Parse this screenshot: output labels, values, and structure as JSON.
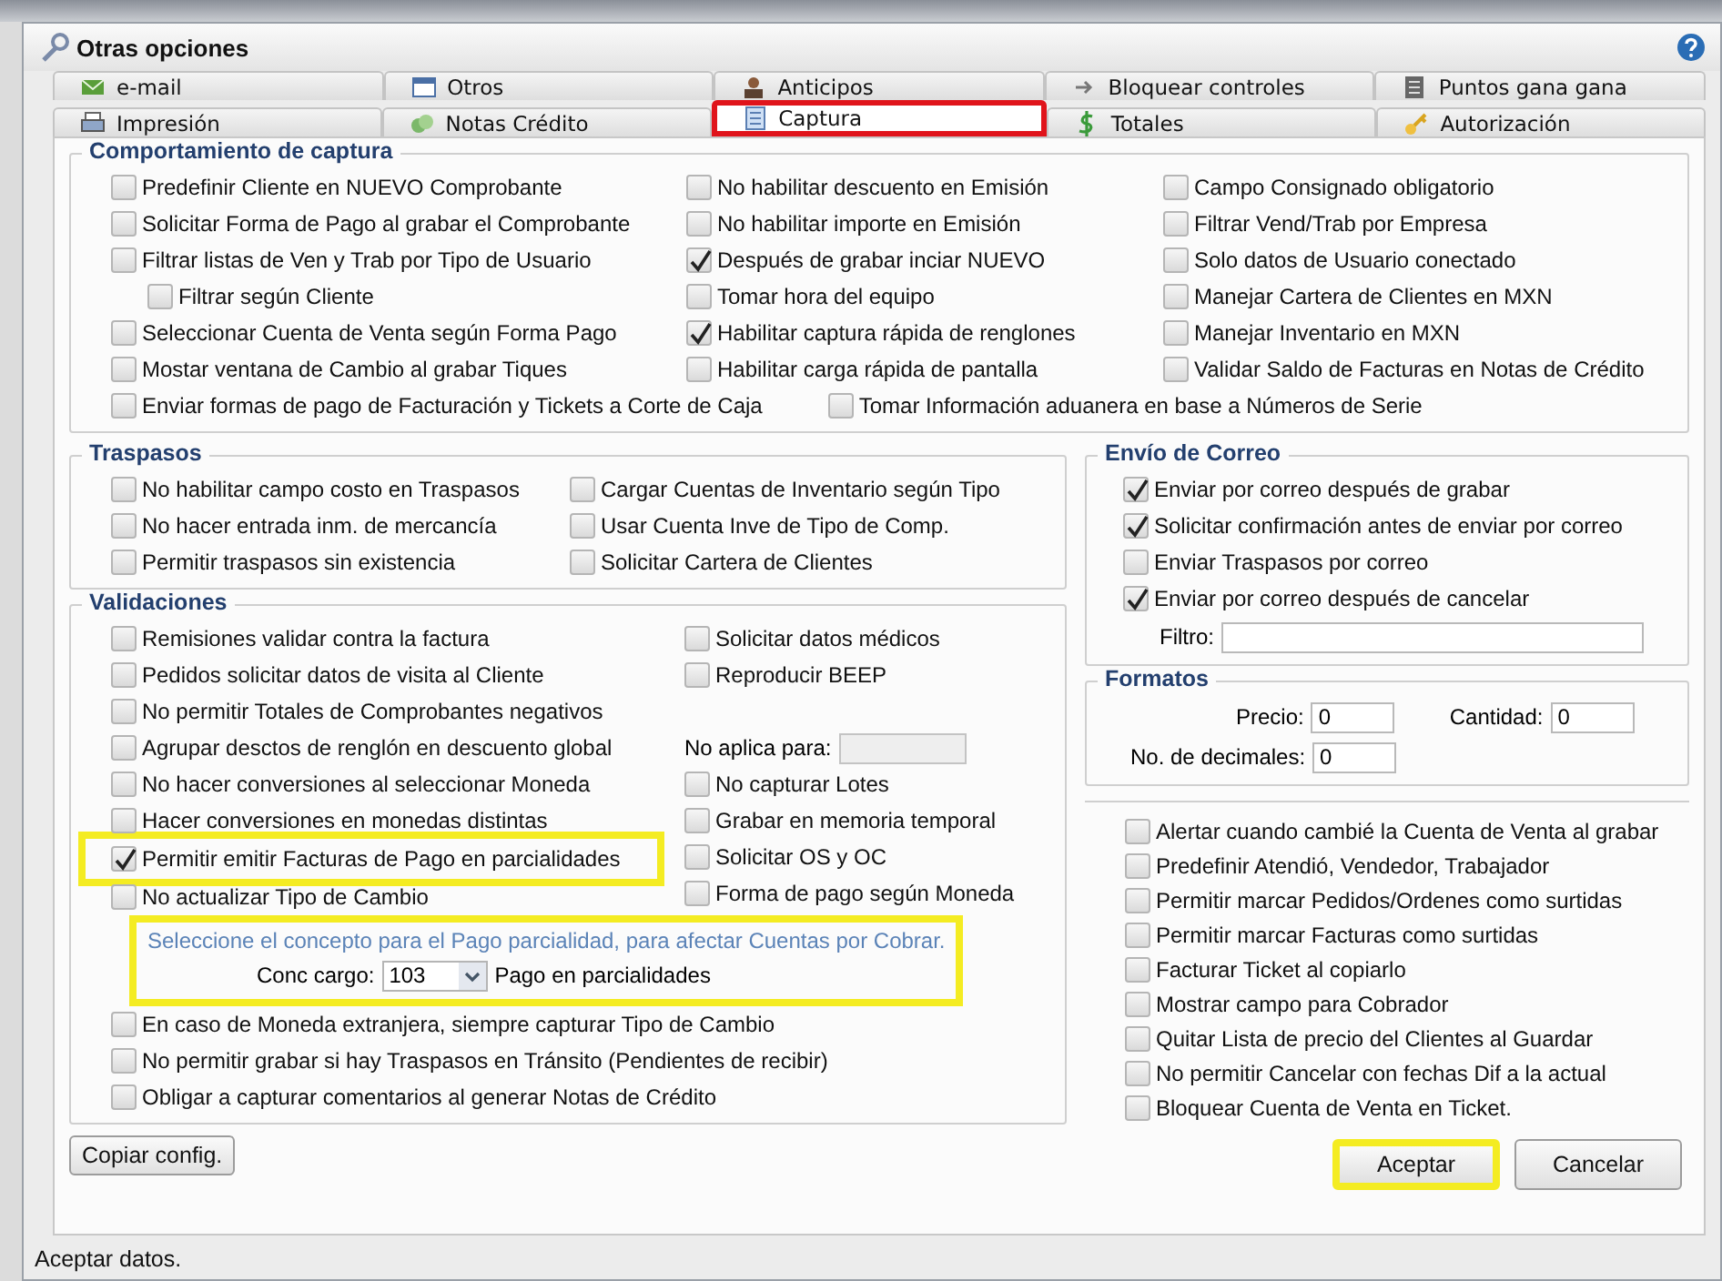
{
  "window": {
    "title": "Otras opciones"
  },
  "tab_rows": [
    {
      "tabs": [
        {
          "label": "e-mail",
          "selected": false,
          "highlighted": false
        },
        {
          "label": "Otros",
          "selected": false,
          "highlighted": false
        },
        {
          "label": "Anticipos",
          "selected": false,
          "highlighted": false
        },
        {
          "label": "Bloquear controles",
          "selected": false,
          "highlighted": false
        },
        {
          "label": "Puntos gana gana",
          "selected": false,
          "highlighted": false
        }
      ]
    },
    {
      "tabs": [
        {
          "label": "Impresión",
          "selected": false,
          "highlighted": false
        },
        {
          "label": "Notas Crédito",
          "selected": false,
          "highlighted": false
        },
        {
          "label": "Captura",
          "selected": true,
          "highlighted": true
        },
        {
          "label": "Totales",
          "selected": false,
          "highlighted": false
        },
        {
          "label": "Autorización",
          "selected": false,
          "highlighted": false
        }
      ]
    }
  ],
  "comportamiento": {
    "title": "Comportamiento de captura",
    "columns": [
      [
        {
          "label": "Predefinir Cliente en NUEVO Comprobante",
          "checked": false
        },
        {
          "label": "Solicitar Forma de Pago al grabar el Comprobante",
          "checked": false
        },
        {
          "label": "Filtrar listas de Ven y Trab por Tipo de Usuario",
          "checked": false,
          "children": [
            {
              "label": "Filtrar según Cliente",
              "checked": false
            }
          ]
        },
        {
          "label": "Seleccionar Cuenta de Venta según Forma Pago",
          "checked": false
        },
        {
          "label": "Mostar ventana de Cambio al grabar Tiques",
          "checked": false
        }
      ],
      [
        {
          "label": "No habilitar descuento en Emisión",
          "checked": false
        },
        {
          "label": "No habilitar importe en Emisión",
          "checked": false
        },
        {
          "label": "Después de grabar inciar NUEVO",
          "checked": true
        },
        {
          "label": "Tomar hora del equipo",
          "checked": false
        },
        {
          "label": "Habilitar captura rápida de renglones",
          "checked": true
        },
        {
          "label": "Habilitar carga rápida de pantalla",
          "checked": false
        }
      ],
      [
        {
          "label": "Campo Consignado obligatorio",
          "checked": false
        },
        {
          "label": "Filtrar Vend/Trab por Empresa",
          "checked": false
        },
        {
          "label": "Solo datos de Usuario conectado",
          "checked": false
        },
        {
          "label": "Manejar Cartera de Clientes en MXN",
          "checked": false
        },
        {
          "label": "Manejar Inventario en MXN",
          "checked": false
        },
        {
          "label": "Validar Saldo de Facturas en Notas de Crédito",
          "checked": false
        }
      ]
    ],
    "footer": [
      {
        "label": "Enviar formas de pago de Facturación y Tickets a Corte de Caja",
        "checked": false
      },
      {
        "label": "Tomar Información aduanera en base a Números de Serie",
        "checked": false
      }
    ]
  },
  "traspasos": {
    "title": "Traspasos",
    "columns": [
      [
        {
          "label": "No habilitar campo costo en Traspasos",
          "checked": false
        },
        {
          "label": "No hacer entrada inm. de mercancía",
          "checked": false
        },
        {
          "label": "Permitir traspasos sin existencia",
          "checked": false
        }
      ],
      [
        {
          "label": "Cargar Cuentas de Inventario según Tipo",
          "checked": false
        },
        {
          "label": "Usar Cuenta Inve de Tipo de Comp.",
          "checked": false
        },
        {
          "label": "Solicitar Cartera de Clientes",
          "checked": false
        }
      ]
    ]
  },
  "validaciones": {
    "title": "Validaciones",
    "left": [
      {
        "label": "Remisiones validar contra la factura",
        "checked": false,
        "highlighted": false
      },
      {
        "label": "Pedidos solicitar datos de visita al Cliente",
        "checked": false,
        "highlighted": false
      },
      {
        "label": "No permitir Totales de Comprobantes negativos",
        "checked": false,
        "highlighted": false
      },
      {
        "label": "Agrupar desctos de renglón en descuento global",
        "checked": false,
        "highlighted": false
      },
      {
        "label": "No hacer conversiones al seleccionar Moneda",
        "checked": false,
        "highlighted": false
      },
      {
        "label": "Hacer conversiones en monedas distintas",
        "checked": false,
        "highlighted": false
      },
      {
        "label": "Permitir emitir Facturas de Pago en parcialidades",
        "checked": true,
        "highlighted": true
      },
      {
        "label": "No actualizar Tipo de Cambio",
        "checked": false,
        "highlighted": false
      }
    ],
    "right": [
      {
        "kind": "checkbox",
        "label": "Solicitar datos médicos",
        "checked": false
      },
      {
        "kind": "checkbox",
        "label": "Reproducir BEEP",
        "checked": false
      },
      {
        "kind": "field",
        "label": "No aplica para:"
      },
      {
        "kind": "checkbox",
        "label": "No capturar Lotes",
        "checked": false
      },
      {
        "kind": "checkbox",
        "label": "Grabar en memoria temporal",
        "checked": false
      },
      {
        "kind": "checkbox",
        "label": "Solicitar OS y OC",
        "checked": false
      },
      {
        "kind": "checkbox",
        "label": "Forma de pago según Moneda",
        "checked": false
      }
    ],
    "concepto": {
      "note": "Seleccione el concepto para el Pago parcialidad, para afectar Cuentas por Cobrar.",
      "label": "Conc cargo:",
      "value": "103",
      "description": "Pago en parcialidades",
      "highlighted": true
    },
    "more": [
      {
        "label": "En caso de Moneda extranjera, siempre capturar Tipo de Cambio",
        "checked": false
      },
      {
        "label": "No permitir grabar si hay Traspasos en Tránsito (Pendientes de recibir)",
        "checked": false
      },
      {
        "label": "Obligar a capturar comentarios al generar Notas de Crédito",
        "checked": false
      }
    ]
  },
  "copy_button": "Copiar config.",
  "correo": {
    "title": "Envío de Correo",
    "items": [
      {
        "label": "Enviar por correo después de grabar",
        "checked": true
      },
      {
        "label": "Solicitar confirmación antes de enviar por correo",
        "checked": true
      },
      {
        "label": "Enviar Traspasos por correo",
        "checked": false
      },
      {
        "label": "Enviar por correo después de cancelar",
        "checked": true
      }
    ],
    "filter_label": "Filtro:"
  },
  "formatos": {
    "title": "Formatos",
    "precio_label": "Precio:",
    "precio": "0",
    "cantidad_label": "Cantidad:",
    "cantidad": "0",
    "decimales_label": "No. de decimales:",
    "decimales": "0"
  },
  "options": [
    {
      "label": "Alertar cuando cambié la Cuenta de Venta al grabar",
      "checked": false
    },
    {
      "label": "Predefinir Atendió, Vendedor, Trabajador",
      "checked": false
    },
    {
      "label": "Permitir marcar Pedidos/Ordenes como surtidas",
      "checked": false
    },
    {
      "label": "Permitir marcar Facturas como surtidas",
      "checked": false
    },
    {
      "label": "Facturar Ticket al copiarlo",
      "checked": false
    },
    {
      "label": "Mostrar campo para Cobrador",
      "checked": false
    },
    {
      "label": "Quitar Lista de precio del Clientes al Guardar",
      "checked": false
    },
    {
      "label": "No permitir Cancelar con fechas Dif a la actual",
      "checked": false
    },
    {
      "label": "Bloquear Cuenta de Venta en Ticket.",
      "checked": false
    }
  ],
  "buttons": [
    {
      "label": "Aceptar",
      "highlighted": true
    },
    {
      "label": "Cancelar",
      "highlighted": false
    }
  ],
  "status_bar": "Aceptar datos."
}
